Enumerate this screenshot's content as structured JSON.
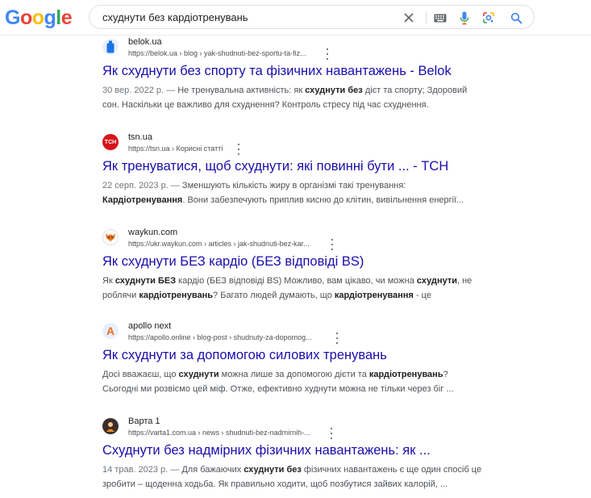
{
  "search": {
    "query": "схуднути без кардіотренувань",
    "clear_icon": "close-icon",
    "keyboard_icon": "keyboard-icon",
    "voice_icon": "mic-icon",
    "lens_icon": "lens-icon",
    "search_icon": "search-icon"
  },
  "logo": {
    "letters": [
      "G",
      "o",
      "o",
      "g",
      "l",
      "e"
    ],
    "colors": [
      "#4285F4",
      "#EA4335",
      "#FBBC05",
      "#4285F4",
      "#34A853",
      "#EA4335"
    ]
  },
  "colors": {
    "link": "#1a0dab",
    "text": "#202124",
    "muted": "#4d5156"
  },
  "results": [
    {
      "site": "belok.ua",
      "url": "https://belok.ua › blog › yak-shudnuti-bez-sportu-ta-fiz...",
      "title": "Як схуднути без спорту та фізичних навантажень - Belok",
      "favicon": "belok-bottle-icon",
      "line1": [
        {
          "t": "30 вер. 2022 р. — ",
          "s": "date"
        },
        {
          "t": "Не тренувальна активність: як ",
          "s": ""
        },
        {
          "t": "схуднути",
          "s": "b"
        },
        {
          "t": " ",
          "s": ""
        },
        {
          "t": "без",
          "s": "b"
        },
        {
          "t": " дієт та спорту; Здоровий",
          "s": ""
        }
      ],
      "line2": [
        {
          "t": "сон. Наскільки це важливо для схуднення? Контроль стресу під час схуднення.",
          "s": ""
        }
      ]
    },
    {
      "site": "tsn.ua",
      "url": "https://tsn.ua › Корисні статті",
      "title": "Як тренуватися, щоб схуднути: які повинні бути ... - ТСН",
      "favicon": "tsn-logo-icon",
      "favicon_text": "ТСН",
      "line1": [
        {
          "t": "22 серп. 2023 р. — ",
          "s": "date"
        },
        {
          "t": "Зменшують кількість жиру в організмі такі тренування:",
          "s": ""
        }
      ],
      "line2": [
        {
          "t": "Кардіотренування",
          "s": "b"
        },
        {
          "t": ". Вони забезпечують приплив кисню до клітин, вивільнення енергії...",
          "s": ""
        }
      ]
    },
    {
      "site": "waykun.com",
      "url": "https://ukr.waykun.com › articles › jak-shudnuti-bez-kar...",
      "title": "Як схуднути БЕЗ кардіо (БЕЗ відповіді BS)",
      "favicon": "waykun-fox-icon",
      "line1": [
        {
          "t": "Як ",
          "s": ""
        },
        {
          "t": "схуднути",
          "s": "b"
        },
        {
          "t": " ",
          "s": ""
        },
        {
          "t": "БЕЗ",
          "s": "b"
        },
        {
          "t": " кардіо (БЕЗ відповіді BS) Можливо, вам цікаво, чи можна ",
          "s": ""
        },
        {
          "t": "схуднути",
          "s": "b"
        },
        {
          "t": ", не",
          "s": ""
        }
      ],
      "line2": [
        {
          "t": "роблячи ",
          "s": ""
        },
        {
          "t": "кардіотренувань",
          "s": "b"
        },
        {
          "t": "? Багато людей думають, що ",
          "s": ""
        },
        {
          "t": "кардіотренування",
          "s": "b"
        },
        {
          "t": " - це",
          "s": ""
        }
      ]
    },
    {
      "site": "apollo next",
      "url": "https://apollo.online › blog-post › shudnuty-za-dopomog...",
      "title": "Як схуднути за допомогою силових тренувань",
      "favicon": "apollo-a-icon",
      "favicon_text": "A",
      "line1": [
        {
          "t": "Досі вважаєш, що ",
          "s": ""
        },
        {
          "t": "схуднути",
          "s": "b"
        },
        {
          "t": " можна лише за допомогою дієти та ",
          "s": ""
        },
        {
          "t": "кардіотренувань",
          "s": "b"
        },
        {
          "t": "?",
          "s": ""
        }
      ],
      "line2": [
        {
          "t": "Сьогодні ми розвіємо цей міф. Отже, ефективно худнути можна не тільки через біг ...",
          "s": ""
        }
      ]
    },
    {
      "site": "Варта 1",
      "url": "https://varta1.com.ua › news › shudnuti-bez-nadmirnih-...",
      "title": "Схуднути без надмірних фізичних навантажень: як ...",
      "favicon": "varta-avatar-icon",
      "line1": [
        {
          "t": "14 трав. 2023 р. — ",
          "s": "date"
        },
        {
          "t": "Для бажаючих ",
          "s": ""
        },
        {
          "t": "схуднути",
          "s": "b"
        },
        {
          "t": " ",
          "s": ""
        },
        {
          "t": "без",
          "s": "b"
        },
        {
          "t": " фізичних навантажень є ще один спосіб це",
          "s": ""
        }
      ],
      "line2": [
        {
          "t": "зробити – щоденна ходьба. Як правильно ходити, щоб позбутися зайвих калорій, ...",
          "s": ""
        }
      ]
    }
  ]
}
